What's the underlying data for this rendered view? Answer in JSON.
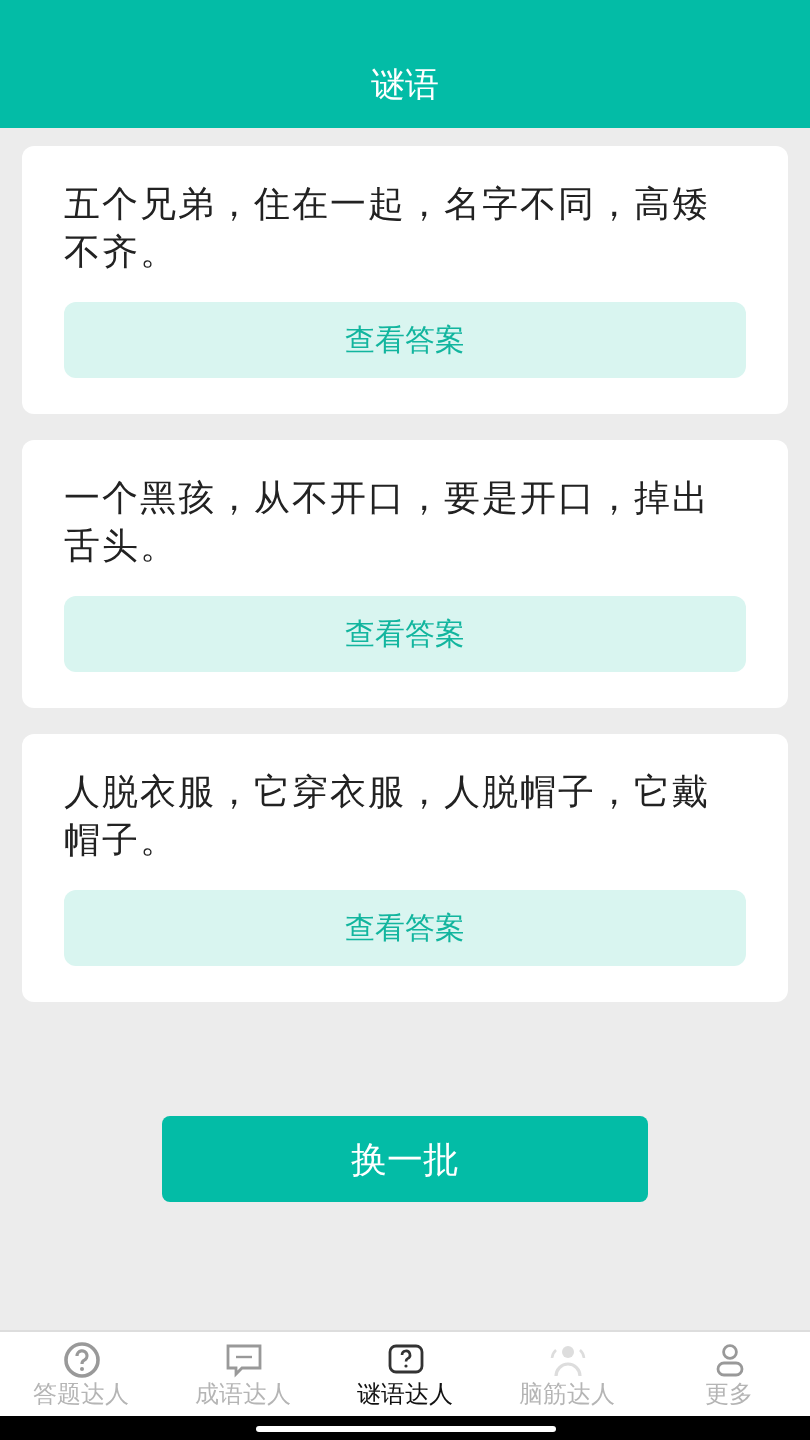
{
  "header": {
    "title": "谜语"
  },
  "riddles": [
    {
      "question": "五个兄弟，住在一起，名字不同，高矮不齐。",
      "button": "查看答案"
    },
    {
      "question": "一个黑孩，从不开口，要是开口，掉出舌头。",
      "button": "查看答案"
    },
    {
      "question": "人脱衣服，它穿衣服，人脱帽子，它戴帽子。",
      "button": "查看答案"
    }
  ],
  "refresh_button": "换一批",
  "tabs": [
    {
      "label": "答题达人",
      "kind": "question",
      "selected": false
    },
    {
      "label": "成语达人",
      "kind": "chat",
      "selected": false
    },
    {
      "label": "谜语达人",
      "kind": "riddle",
      "selected": true
    },
    {
      "label": "脑筋达人",
      "kind": "people",
      "selected": false
    },
    {
      "label": "更多",
      "kind": "person",
      "selected": false
    }
  ]
}
